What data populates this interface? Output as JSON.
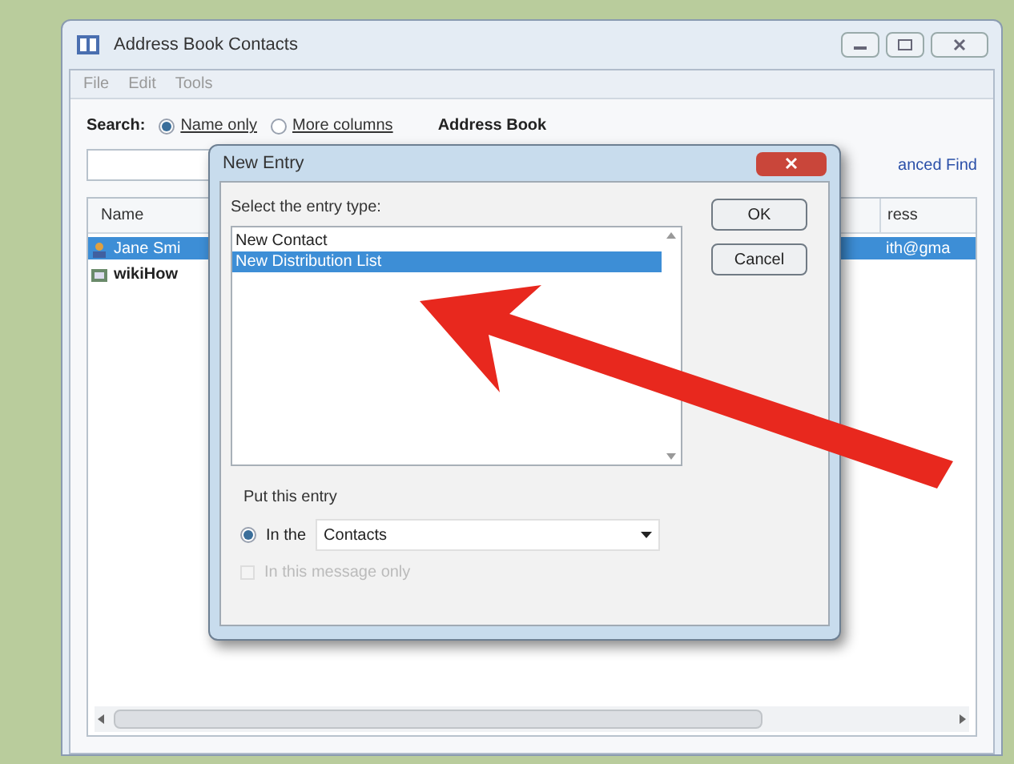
{
  "window": {
    "title": "Address Book Contacts"
  },
  "menu": [
    "File",
    "Edit",
    "Tools"
  ],
  "search": {
    "label": "Search:",
    "options": [
      {
        "label": "Name only",
        "selected": true
      },
      {
        "label": "More columns",
        "selected": false
      }
    ],
    "book_label": "Address Book",
    "link": "anced Find"
  },
  "table": {
    "columns": [
      "Name",
      "ress"
    ],
    "rows": [
      {
        "name": "Jane Smi",
        "email": "ith@gma",
        "selected": true,
        "kind": "contact"
      },
      {
        "name": "wikiHow",
        "email": "",
        "selected": false,
        "kind": "list"
      }
    ]
  },
  "dialog": {
    "title": "New Entry",
    "prompt": "Select the entry type:",
    "items": [
      {
        "label": "New Contact",
        "selected": false
      },
      {
        "label": "New Distribution List",
        "selected": true
      }
    ],
    "buttons": [
      "OK",
      "Cancel"
    ],
    "group_label": "Put this entry",
    "in_the": {
      "label": "In the",
      "selected": true,
      "value": "Contacts"
    },
    "message_only": {
      "label": "In this message only",
      "checked": false,
      "disabled": true
    }
  }
}
